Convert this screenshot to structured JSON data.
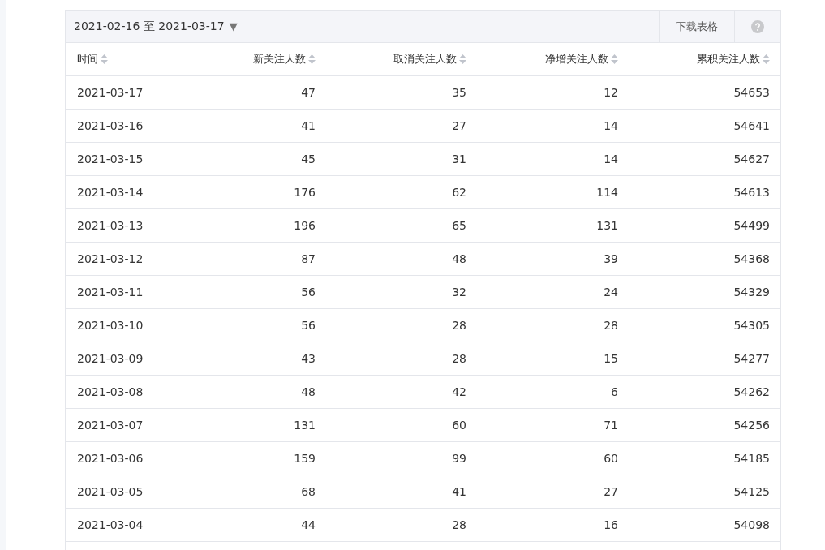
{
  "toolbar": {
    "date_range": "2021-02-16 至 2021-03-17",
    "dropdown_glyph": "▼",
    "download_button": "下载表格"
  },
  "table": {
    "columns": [
      "时间",
      "新关注人数",
      "取消关注人数",
      "净增关注人数",
      "累积关注人数"
    ],
    "rows": [
      [
        "2021-03-17",
        "47",
        "35",
        "12",
        "54653"
      ],
      [
        "2021-03-16",
        "41",
        "27",
        "14",
        "54641"
      ],
      [
        "2021-03-15",
        "45",
        "31",
        "14",
        "54627"
      ],
      [
        "2021-03-14",
        "176",
        "62",
        "114",
        "54613"
      ],
      [
        "2021-03-13",
        "196",
        "65",
        "131",
        "54499"
      ],
      [
        "2021-03-12",
        "87",
        "48",
        "39",
        "54368"
      ],
      [
        "2021-03-11",
        "56",
        "32",
        "24",
        "54329"
      ],
      [
        "2021-03-10",
        "56",
        "28",
        "28",
        "54305"
      ],
      [
        "2021-03-09",
        "43",
        "28",
        "15",
        "54277"
      ],
      [
        "2021-03-08",
        "48",
        "42",
        "6",
        "54262"
      ],
      [
        "2021-03-07",
        "131",
        "60",
        "71",
        "54256"
      ],
      [
        "2021-03-06",
        "159",
        "99",
        "60",
        "54185"
      ],
      [
        "2021-03-05",
        "68",
        "41",
        "27",
        "54125"
      ],
      [
        "2021-03-04",
        "44",
        "28",
        "16",
        "54098"
      ]
    ]
  }
}
